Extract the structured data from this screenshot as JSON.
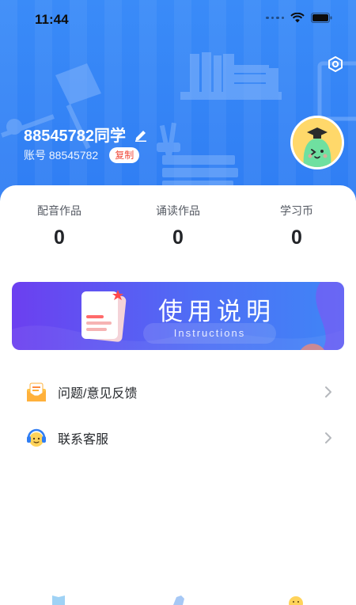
{
  "status_bar": {
    "time": "11:44"
  },
  "profile": {
    "username": "88545782同学",
    "account_label": "账号",
    "account_number": "88545782",
    "copy_label": "复制"
  },
  "stats": [
    {
      "label": "配音作品",
      "value": "0"
    },
    {
      "label": "诵读作品",
      "value": "0"
    },
    {
      "label": "学习币",
      "value": "0"
    }
  ],
  "banner": {
    "title": "使用说明",
    "subtitle": "Instructions"
  },
  "menu": [
    {
      "label": "问题/意见反馈",
      "icon": "feedback-envelope-icon"
    },
    {
      "label": "联系客服",
      "icon": "customer-service-icon"
    }
  ],
  "tabbar": {
    "icons": [
      "book-tab-icon",
      "star-tab-icon",
      "face-tab-icon"
    ]
  },
  "colors": {
    "header_blue": "#3a8bf8",
    "copy_red": "#f04a3b",
    "banner_purple": "#6c3ff0",
    "banner_blue": "#3f86f6"
  }
}
